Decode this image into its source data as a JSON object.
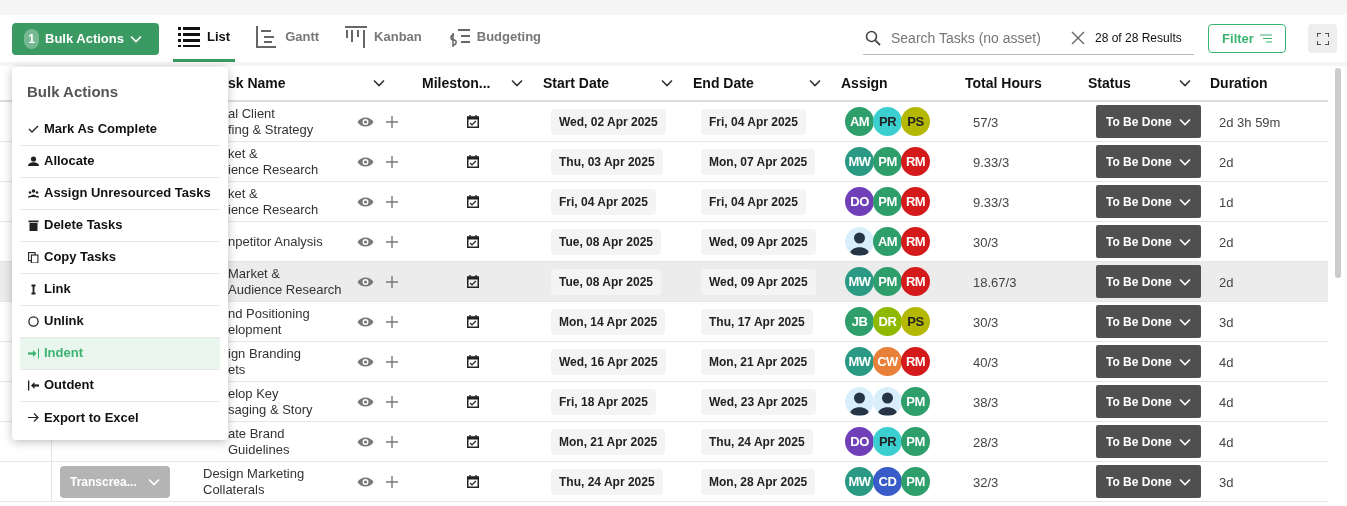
{
  "toolbar": {
    "bulk_button": {
      "count": "1",
      "label": "Bulk Actions"
    },
    "view_tabs": [
      {
        "label": "List",
        "kind": "list",
        "selected": true
      },
      {
        "label": "Gantt",
        "kind": "gantt",
        "selected": false
      },
      {
        "label": "Kanban",
        "kind": "kanban",
        "selected": false
      },
      {
        "label": "Budgeting",
        "kind": "budget",
        "selected": false
      }
    ],
    "search": {
      "placeholder": "Search Tasks (no asset)"
    },
    "results": "28 of 28 Results",
    "filter_button": "Filter"
  },
  "table": {
    "columns": [
      {
        "label": "sk Name",
        "has_menu": true
      },
      {
        "label": "Mileston...",
        "has_menu": true
      },
      {
        "label": "Start Date",
        "has_menu": true
      },
      {
        "label": "End Date",
        "has_menu": true
      },
      {
        "label": "Assign",
        "has_menu": false
      },
      {
        "label": "Total Hours",
        "has_menu": false
      },
      {
        "label": "Status",
        "has_menu": true
      },
      {
        "label": "Duration",
        "has_menu": false
      }
    ],
    "rows": [
      {
        "task": [
          "al Client",
          "fing & Strategy"
        ],
        "covered": true,
        "highlighted": false,
        "start": "Wed, 02 Apr 2025",
        "end": "Fri, 04 Apr 2025",
        "assign": [
          {
            "initials": "AM",
            "color": "#2e9e6a"
          },
          {
            "initials": "PR",
            "color": "#3ccfcf"
          },
          {
            "initials": "PS",
            "color": "#b5b800"
          }
        ],
        "hours": "57/3",
        "status": "To Be Done",
        "duration": "2d 3h 59m"
      },
      {
        "task": [
          "ket &",
          "ience Research"
        ],
        "covered": true,
        "highlighted": false,
        "start": "Thu, 03 Apr 2025",
        "end": "Mon, 07 Apr 2025",
        "assign": [
          {
            "initials": "MW",
            "color": "#2a9a84"
          },
          {
            "initials": "PM",
            "color": "#2e9e6a"
          },
          {
            "initials": "RM",
            "color": "#d41a1a"
          }
        ],
        "hours": "9.33/3",
        "status": "To Be Done",
        "duration": "2d"
      },
      {
        "task": [
          "ket &",
          "ience Research"
        ],
        "covered": true,
        "highlighted": false,
        "start": "Fri, 04 Apr 2025",
        "end": "Fri, 04 Apr 2025",
        "assign": [
          {
            "initials": "DO",
            "color": "#7040b8"
          },
          {
            "initials": "PM",
            "color": "#2e9e6a"
          },
          {
            "initials": "RM",
            "color": "#d41a1a"
          }
        ],
        "hours": "9.33/3",
        "status": "To Be Done",
        "duration": "1d"
      },
      {
        "task": [
          "npetitor Analysis"
        ],
        "covered": true,
        "highlighted": false,
        "start": "Tue, 08 Apr 2025",
        "end": "Wed, 09 Apr 2025",
        "assign": [
          {
            "kind": "person"
          },
          {
            "initials": "AM",
            "color": "#2e9e6a"
          },
          {
            "initials": "RM",
            "color": "#d41a1a"
          }
        ],
        "hours": "30/3",
        "status": "To Be Done",
        "duration": "2d"
      },
      {
        "task": [
          "Market &",
          "Audience Research"
        ],
        "covered": true,
        "highlighted": true,
        "start": "Tue, 08 Apr 2025",
        "end": "Wed, 09 Apr 2025",
        "assign": [
          {
            "initials": "MW",
            "color": "#2a9a84"
          },
          {
            "initials": "PM",
            "color": "#2e9e6a"
          },
          {
            "initials": "RM",
            "color": "#d41a1a"
          }
        ],
        "hours": "18.67/3",
        "status": "To Be Done",
        "duration": "2d"
      },
      {
        "task": [
          "nd Positioning",
          "elopment"
        ],
        "covered": true,
        "highlighted": false,
        "start": "Mon, 14 Apr 2025",
        "end": "Thu, 17 Apr 2025",
        "assign": [
          {
            "initials": "JB",
            "color": "#2e9e6a"
          },
          {
            "initials": "DR",
            "color": "#8fb800"
          },
          {
            "initials": "PS",
            "color": "#b5b800"
          }
        ],
        "hours": "30/3",
        "status": "To Be Done",
        "duration": "3d"
      },
      {
        "task": [
          "ign Branding",
          "ets"
        ],
        "covered": true,
        "highlighted": false,
        "start": "Wed, 16 Apr 2025",
        "end": "Mon, 21 Apr 2025",
        "assign": [
          {
            "initials": "MW",
            "color": "#2a9a84"
          },
          {
            "initials": "CW",
            "color": "#e8803a"
          },
          {
            "initials": "RM",
            "color": "#d41a1a"
          }
        ],
        "hours": "40/3",
        "status": "To Be Done",
        "duration": "4d"
      },
      {
        "task": [
          "elop Key",
          "saging & Story"
        ],
        "covered": true,
        "highlighted": false,
        "start": "Fri, 18 Apr 2025",
        "end": "Wed, 23 Apr 2025",
        "assign": [
          {
            "kind": "person"
          },
          {
            "kind": "person"
          },
          {
            "initials": "PM",
            "color": "#2e9e6a"
          }
        ],
        "hours": "38/3",
        "status": "To Be Done",
        "duration": "4d"
      },
      {
        "task": [
          "ate Brand",
          "Guidelines"
        ],
        "covered": true,
        "highlighted": false,
        "start": "Mon, 21 Apr 2025",
        "end": "Thu, 24 Apr 2025",
        "assign": [
          {
            "initials": "DO",
            "color": "#7040b8"
          },
          {
            "initials": "PR",
            "color": "#3ccfcf"
          },
          {
            "initials": "PM",
            "color": "#2e9e6a"
          }
        ],
        "hours": "28/3",
        "status": "To Be Done",
        "duration": "4d"
      },
      {
        "task": [
          "Design Marketing",
          "Collaterals"
        ],
        "covered": false,
        "highlighted": false,
        "column_2": "Transcrea...",
        "start": "Thu, 24 Apr 2025",
        "end": "Mon, 28 Apr 2025",
        "assign": [
          {
            "initials": "MW",
            "color": "#2a9a84"
          },
          {
            "initials": "CD",
            "color": "#3a5cc8"
          },
          {
            "initials": "PM",
            "color": "#2e9e6a"
          }
        ],
        "hours": "32/3",
        "status": "To Be Done",
        "duration": "3d"
      }
    ]
  },
  "bulk_menu": {
    "title": "Bulk Actions",
    "items": [
      {
        "label": "Mark As Complete",
        "kind": "check",
        "selected": false
      },
      {
        "label": "Allocate",
        "kind": "person",
        "selected": false
      },
      {
        "label": "Assign Unresourced Tasks",
        "kind": "people",
        "selected": false
      },
      {
        "label": "Delete Tasks",
        "kind": "trash",
        "selected": false
      },
      {
        "label": "Copy Tasks",
        "kind": "copy",
        "selected": false
      },
      {
        "label": "Link",
        "kind": "link",
        "selected": false
      },
      {
        "label": "Unlink",
        "kind": "unlink",
        "selected": false
      },
      {
        "label": "Indent",
        "kind": "indent",
        "selected": true
      },
      {
        "label": "Outdent",
        "kind": "outdent",
        "selected": false
      },
      {
        "label": "Export to Excel",
        "kind": "export",
        "selected": false
      }
    ]
  }
}
